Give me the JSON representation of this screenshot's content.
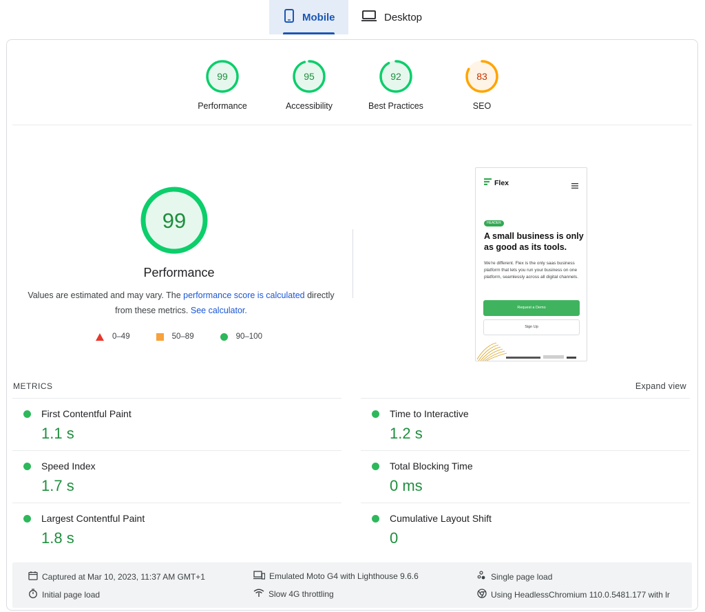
{
  "tabs": {
    "mobile": "Mobile",
    "desktop": "Desktop"
  },
  "scores": [
    {
      "label": "Performance",
      "value": 99,
      "color": "#0cce6b"
    },
    {
      "label": "Accessibility",
      "value": 95,
      "color": "#0cce6b"
    },
    {
      "label": "Best Practices",
      "value": 92,
      "color": "#0cce6b"
    },
    {
      "label": "SEO",
      "value": 83,
      "color": "#ffa400"
    }
  ],
  "performance": {
    "score": 99,
    "title": "Performance",
    "desc_prefix": "Values are estimated and may vary. The ",
    "desc_link1": "performance score is calculated",
    "desc_middle": " directly from these metrics. ",
    "desc_link2": "See calculator."
  },
  "legend": {
    "fail": "0–49",
    "average": "50–89",
    "pass": "90–100"
  },
  "preview": {
    "logo": "Flex",
    "badge": "HEADER",
    "heading": "A small business is only as good as its tools.",
    "paragraph": "We're different. Flex is the only saas business platform that lets you run your business on one platform, seamlessly across all digital channels.",
    "primary_button": "Request a Demo",
    "secondary_button": "Sign Up"
  },
  "metrics": {
    "header": "METRICS",
    "expand_label": "Expand view",
    "items": [
      {
        "label": "First Contentful Paint",
        "value": "1.1 s"
      },
      {
        "label": "Time to Interactive",
        "value": "1.2 s"
      },
      {
        "label": "Speed Index",
        "value": "1.7 s"
      },
      {
        "label": "Total Blocking Time",
        "value": "0 ms"
      },
      {
        "label": "Largest Contentful Paint",
        "value": "1.8 s"
      },
      {
        "label": "Cumulative Layout Shift",
        "value": "0"
      }
    ]
  },
  "footer": {
    "captured": "Captured at Mar 10, 2023, 11:37 AM GMT+1",
    "initial_load": "Initial page load",
    "emulated": "Emulated Moto G4 with Lighthouse 9.6.6",
    "throttling": "Slow 4G throttling",
    "single_load": "Single page load",
    "browser": "Using HeadlessChromium 110.0.5481.177 with lr"
  },
  "colors": {
    "pass": "#0cce6b",
    "average": "#ffa400",
    "fail": "#ff4e42",
    "pass_text": "#1e8e3e",
    "average_text": "#c33300",
    "link": "#1a56d6",
    "tab_active": "#1a56b4"
  }
}
